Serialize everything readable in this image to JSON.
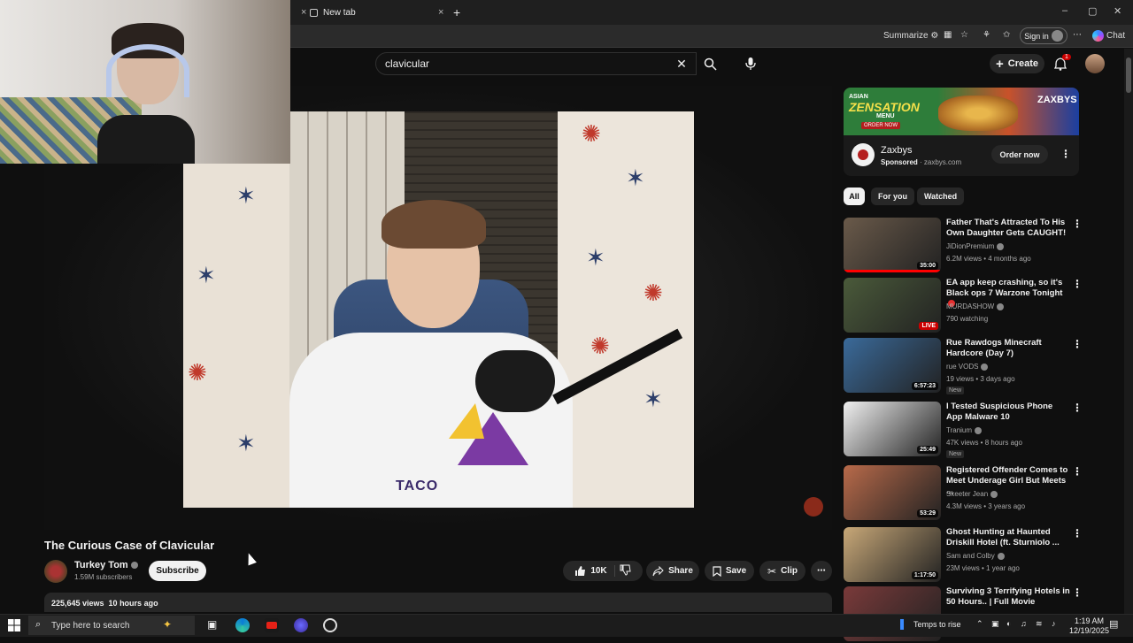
{
  "browser": {
    "tab_label": "New tab",
    "tab_close": "×",
    "new_tab": "+",
    "summarize": "Summarize",
    "sign_in": "Sign in",
    "chat": "Chat",
    "window_min": "–",
    "window_max": "▢",
    "window_close": "✕"
  },
  "header": {
    "search_value": "clavicular",
    "create_label": "Create",
    "notification_count": "1"
  },
  "video": {
    "title": "The Curious Case of Clavicular",
    "overlay_text": "TACO"
  },
  "channel": {
    "name": "Turkey Tom",
    "subscribers": "1.59M subscribers",
    "subscribe_label": "Subscribe"
  },
  "actions": {
    "likes": "10K",
    "share": "Share",
    "save": "Save",
    "clip": "Clip",
    "more": "⋯"
  },
  "description": {
    "stats": "225,645 views  10 hours ago"
  },
  "ad": {
    "banner_sub": "ASIAN",
    "banner_title": "ZENSATION",
    "banner_menu": "MENU",
    "banner_order": "ORDER NOW",
    "banner_brand": "ZAXBYS",
    "name": "Zaxbys",
    "sponsored": "Sponsored",
    "domain": " · zaxbys.com",
    "cta": "Order now"
  },
  "chips": [
    "All",
    "For you",
    "Watched"
  ],
  "recommendations": [
    {
      "title": "Father That's Attracted To His Own Daughter Gets CAUGHT!",
      "channel": "JiDionPremium",
      "meta": "6.2M views • 4 months ago",
      "duration": "35:00",
      "live": false,
      "new": false,
      "progress": 1.0,
      "thumb_color": "#6a5a4a"
    },
    {
      "title": "EA app keep crashing, so it's Black ops 7 Warzone Tonight",
      "channel": "MURDASHOW",
      "meta": "790 watching",
      "duration": "LIVE",
      "live": true,
      "new": false,
      "progress": 0,
      "thumb_color": "#4a5a3a"
    },
    {
      "title": "Rue Rawdogs Minecraft Hardcore (Day 7)",
      "channel": "rue VODS",
      "meta": "19 views • 3 days ago",
      "duration": "6:57:23",
      "live": false,
      "new": true,
      "new_label": "New",
      "progress": 0,
      "thumb_color": "#3a6a9a"
    },
    {
      "title": "I Tested Suspicious Phone App Malware 10",
      "channel": "Tranium",
      "meta": "47K views • 8 hours ago",
      "duration": "25:49",
      "live": false,
      "new": true,
      "new_label": "New",
      "progress": 0,
      "thumb_color": "#f0f0f0"
    },
    {
      "title": "Registered Offender Comes to Meet Underage Girl But Meets ...",
      "channel": "Skeeter Jean",
      "meta": "4.3M views • 3 years ago",
      "duration": "53:29",
      "live": false,
      "new": false,
      "progress": 0,
      "thumb_color": "#b86a4a"
    },
    {
      "title": "Ghost Hunting at Haunted Driskill Hotel (ft. Sturniolo ...",
      "channel": "Sam and Colby",
      "meta": "23M views • 1 year ago",
      "duration": "1:17:50",
      "live": false,
      "new": false,
      "progress": 0,
      "thumb_color": "#c8a878"
    },
    {
      "title": "Surviving 3 Terrifying Hotels in 50 Hours.. | Full Movie",
      "channel": "",
      "meta": "",
      "duration": "",
      "live": false,
      "new": false,
      "progress": 0,
      "thumb_color": "#7a3a3a"
    }
  ],
  "taskbar": {
    "search_placeholder": "Type here to search",
    "weather": "Temps to rise",
    "time": "1:19 AM",
    "date": "12/19/2025"
  }
}
